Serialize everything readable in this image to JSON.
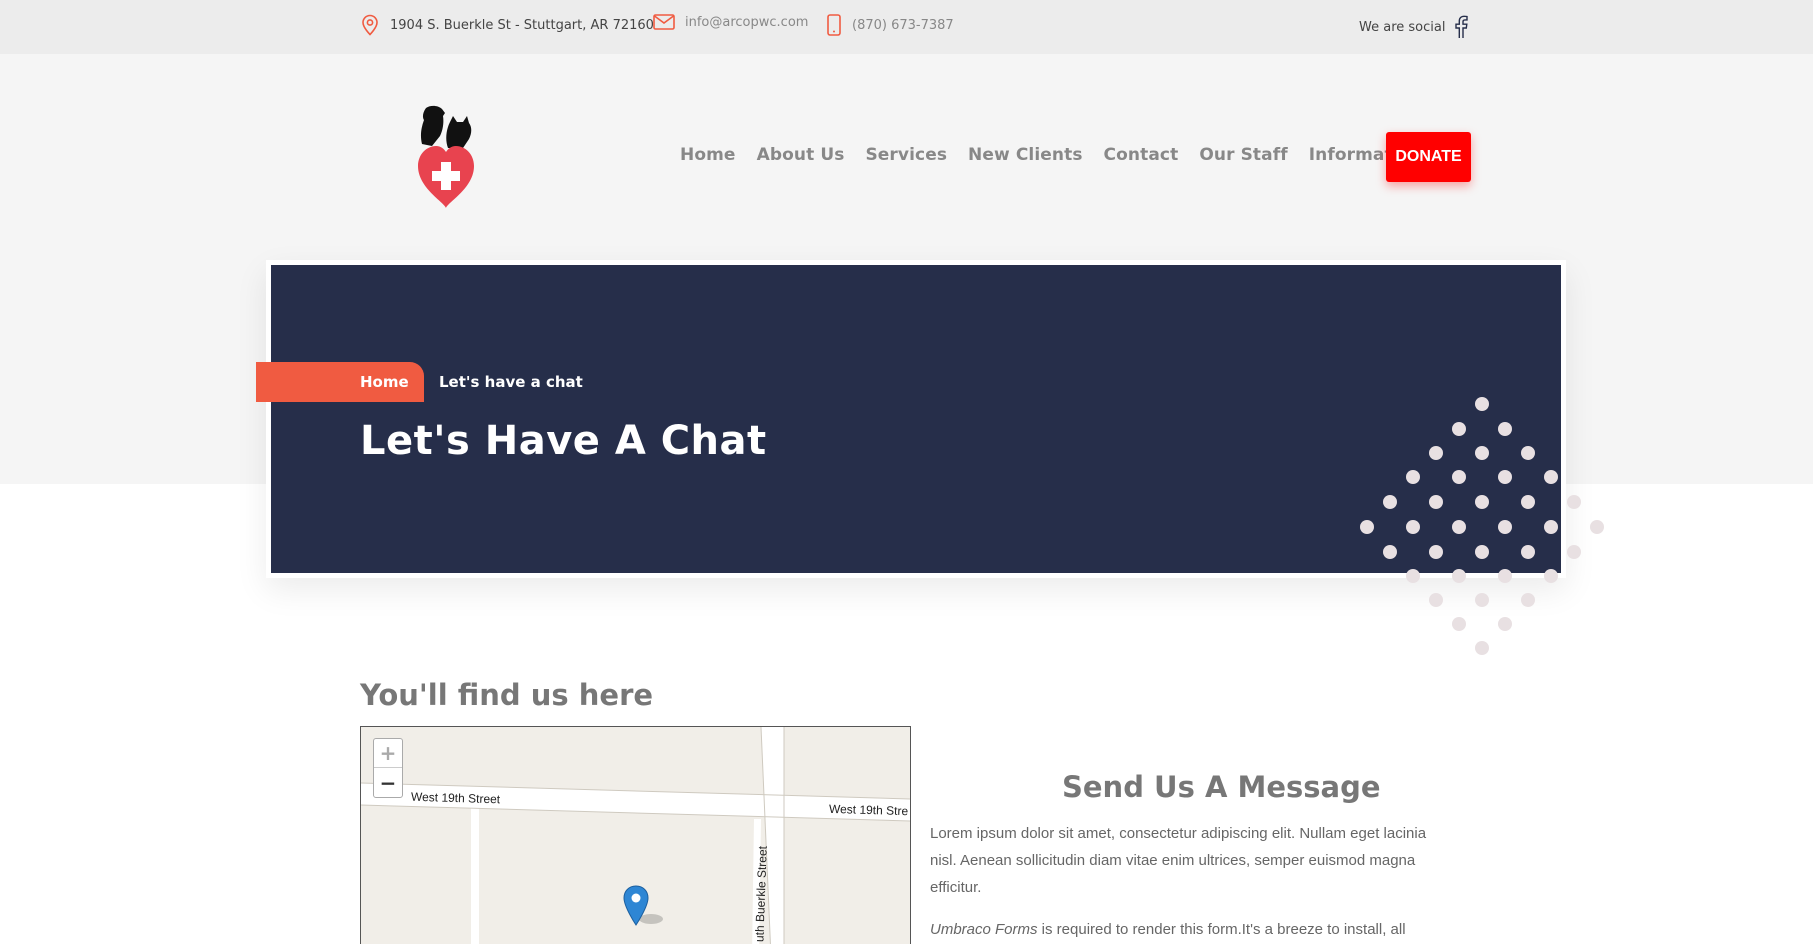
{
  "topbar": {
    "address": "1904 S. Buerkle St - Stuttgart, AR 72160",
    "email": "info@arcopwc.com",
    "phone": "(870) 673-7387",
    "social_label": "We are social"
  },
  "icons": {
    "address": "map-pin-icon",
    "email": "envelope-icon",
    "phone": "mobile-phone-icon",
    "social": "facebook-icon"
  },
  "colors": {
    "accent": "#f05b41",
    "donate": "#ff0000",
    "hero_bg": "#262e4a"
  },
  "nav": {
    "items": [
      "Home",
      "About Us",
      "Services",
      "New Clients",
      "Contact",
      "Our Staff",
      "Information"
    ],
    "donate_label": "DONATE"
  },
  "hero": {
    "breadcrumb_home": "Home",
    "breadcrumb_current": "Let's have a chat",
    "title": "Let's Have A Chat"
  },
  "location": {
    "title": "You'll find us here",
    "zoom_in": "+",
    "zoom_out": "−",
    "street_1": "West 19th Street",
    "street_2": "West 19th Stre",
    "street_3": "uth Buerkle Street"
  },
  "message": {
    "title": "Send Us A Message",
    "body": "Lorem ipsum dolor sit amet, consectetur adipiscing elit. Nullam eget lacinia nisl. Aenean sollicitudin diam vitae enim ultrices, semper euismod magna efficitur.",
    "forms_name": "Umbraco Forms",
    "forms_rest": " is required to render this form.It's a breeze to install, all"
  }
}
